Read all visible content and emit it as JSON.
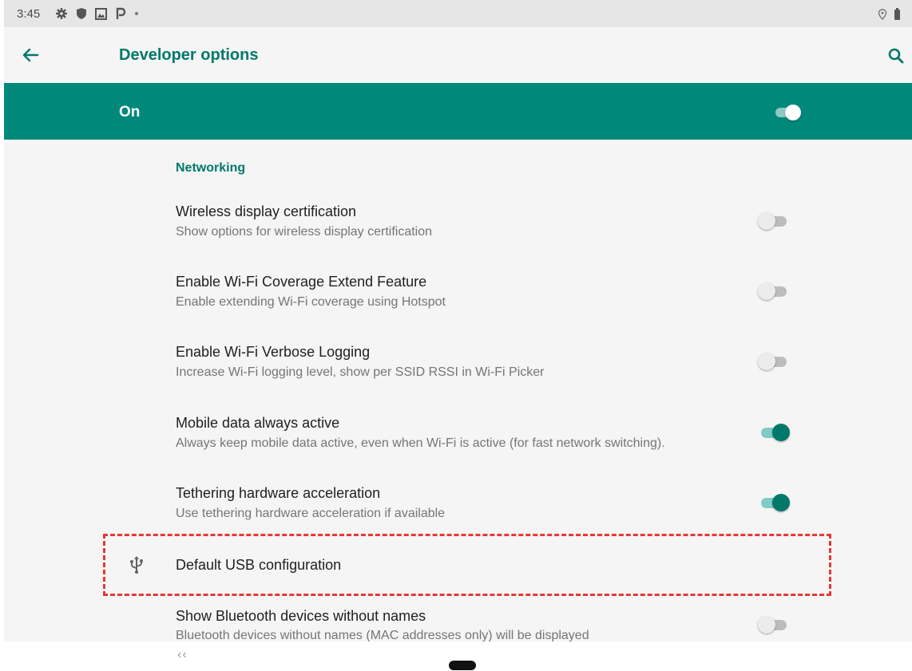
{
  "status_bar": {
    "time": "3:45",
    "icons": [
      "settings-gear-icon",
      "shield-icon",
      "image-notification-icon",
      "parking-p-icon",
      "notification-dot-icon"
    ],
    "right_icons": [
      "location-icon",
      "battery-icon"
    ]
  },
  "toolbar": {
    "title": "Developer options",
    "back_icon": "arrow-back-icon",
    "search_icon": "search-icon"
  },
  "master_switch": {
    "label": "On",
    "state": true
  },
  "section": {
    "header": "Networking",
    "items": [
      {
        "title": "Wireless display certification",
        "subtitle": "Show options for wireless display certification",
        "toggle": false
      },
      {
        "title": "Enable Wi-Fi Coverage Extend Feature",
        "subtitle": "Enable extending Wi-Fi coverage using Hotspot",
        "toggle": false
      },
      {
        "title": "Enable Wi-Fi Verbose Logging",
        "subtitle": "Increase Wi-Fi logging level, show per SSID RSSI in Wi-Fi Picker",
        "toggle": false
      },
      {
        "title": "Mobile data always active",
        "subtitle": "Always keep mobile data active, even when Wi-Fi is active (for fast network switching).",
        "toggle": true
      },
      {
        "title": "Tethering hardware acceleration",
        "subtitle": "Use tethering hardware acceleration if available",
        "toggle": true
      },
      {
        "title": "Default USB configuration",
        "icon": "usb-icon"
      },
      {
        "title": "Show Bluetooth devices without names",
        "subtitle": "Bluetooth devices without names (MAC addresses only) will be displayed",
        "toggle": false
      }
    ]
  },
  "nav_bar": {
    "back_label": "‹‹",
    "home_icon": "home-pill-icon"
  },
  "colors": {
    "accent": "#00796b",
    "master_bar": "#00897b",
    "highlight": "#e53935"
  }
}
